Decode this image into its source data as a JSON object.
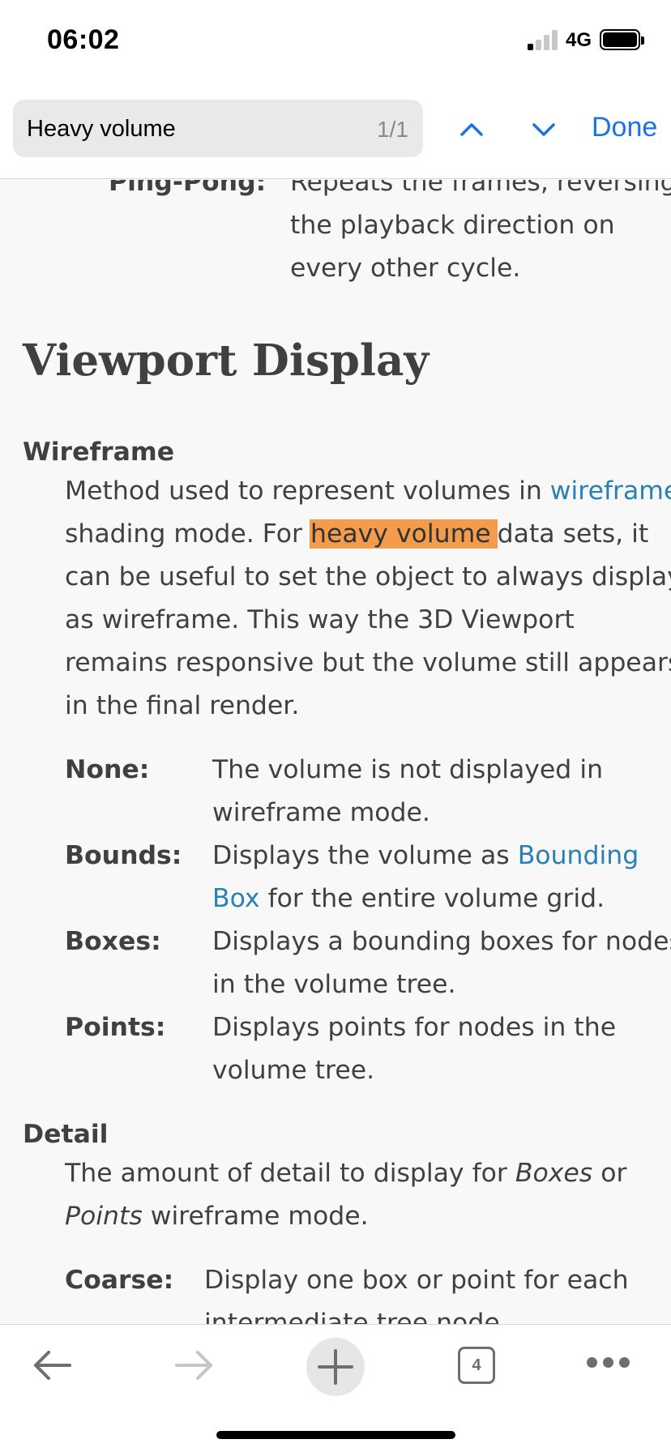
{
  "status_bar": {
    "time": "06:02",
    "network": "4G"
  },
  "find_bar": {
    "query": "Heavy volume",
    "count": "1/1",
    "done_label": "Done"
  },
  "content": {
    "pingpong_term": "Ping-Pong:",
    "pingpong_lines": [
      "Repeats the frames, reversing",
      "the playback direction on",
      "every other cycle."
    ],
    "heading": "Viewport Display",
    "wireframe_term": "Wireframe",
    "wireframe_line1_pre": "Method used to represent volumes in ",
    "wireframe_line1_link": "wireframe",
    "wireframe_line2_pre": "shading mode. For ",
    "wireframe_line2_highlight": "heavy volume",
    "wireframe_line2_post": "data sets, it",
    "wireframe_lines_rest": [
      "can be useful to set the object to always display",
      "as wireframe. This way the 3D Viewport",
      "remains responsive but the volume still appears",
      "in the final render."
    ],
    "options": {
      "none_term": "None:",
      "none_lines": [
        "The volume is not displayed in",
        "wireframe mode."
      ],
      "bounds_term": "Bounds:",
      "bounds_line1_pre": "Displays the volume as ",
      "bounds_line1_link": "Bounding",
      "bounds_line2_link": "Box",
      "bounds_line2_post": " for the entire volume grid.",
      "boxes_term": "Boxes:",
      "boxes_lines": [
        "Displays a bounding boxes for nodes",
        "in the volume tree."
      ],
      "points_term": "Points:",
      "points_lines": [
        "Displays points for nodes in the",
        "volume tree."
      ]
    },
    "detail_term": "Detail",
    "detail_line1_pre": "The amount of detail to display for ",
    "detail_line1_em": "Boxes",
    "detail_line1_post": " or",
    "detail_line2_em": "Points",
    "detail_line2_post": " wireframe mode.",
    "coarse_term": "Coarse:",
    "coarse_lines": [
      "Display one box or point for each",
      "intermediate tree node."
    ]
  },
  "toolbar": {
    "tabs_count": "4"
  }
}
